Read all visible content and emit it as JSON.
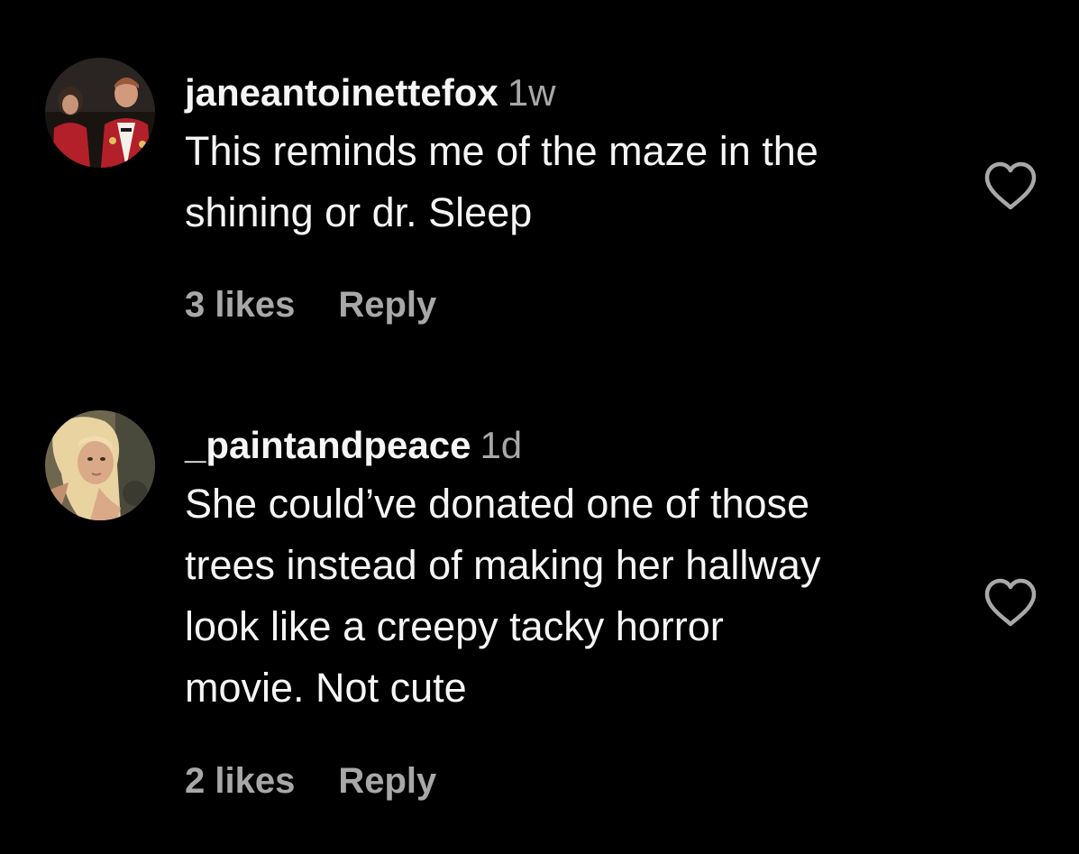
{
  "comments": [
    {
      "username": "janeantoinettefox",
      "time": "1w",
      "text_lines": [
        "This reminds me of the maze in the",
        "shining or dr. Sleep"
      ],
      "likes": "3 likes",
      "reply": "Reply",
      "heart_icon": "heart-outline-icon"
    },
    {
      "username": "_paintandpeace",
      "time": "1d",
      "text_lines": [
        "She could’ve donated one of those",
        "trees instead of making her hallway",
        "look like a creepy tacky horror",
        "movie. Not cute"
      ],
      "likes": "2 likes",
      "reply": "Reply",
      "heart_icon": "heart-outline-icon"
    }
  ],
  "colors": {
    "background": "#000000",
    "primary_text": "#f5f5f5",
    "secondary_text": "#a8a8a8"
  }
}
